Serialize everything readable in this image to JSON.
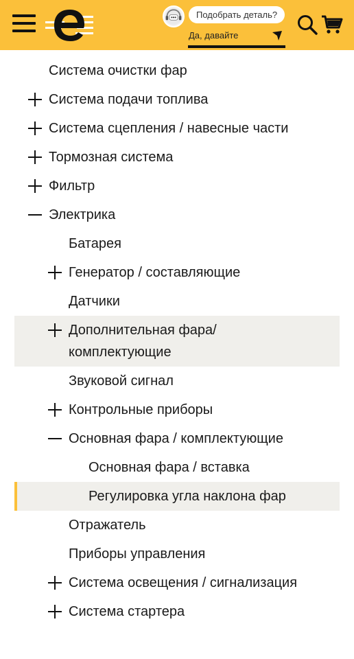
{
  "header": {
    "chat_bubble": "Подобрать деталь?",
    "reply_text": "Да, давайте",
    "brand_color": "#fbc03a"
  },
  "tree": [
    {
      "label": "Система очистки фар",
      "level": 0,
      "toggle": "none"
    },
    {
      "label": "Система подачи топлива",
      "level": 0,
      "toggle": "plus"
    },
    {
      "label": "Система сцепления / навесные части",
      "level": 0,
      "toggle": "plus"
    },
    {
      "label": "Тормозная система",
      "level": 0,
      "toggle": "plus"
    },
    {
      "label": "Фильтр",
      "level": 0,
      "toggle": "plus"
    },
    {
      "label": "Электрика",
      "level": 0,
      "toggle": "minus"
    },
    {
      "label": "Батарея",
      "level": 1,
      "toggle": "none"
    },
    {
      "label": "Генератор / составляющие",
      "level": 1,
      "toggle": "plus"
    },
    {
      "label": "Датчики",
      "level": 1,
      "toggle": "none"
    },
    {
      "label": "Дополнительная фара/ комплектующие",
      "level": 1,
      "toggle": "plus",
      "state": "hover"
    },
    {
      "label": "Звуковой сигнал",
      "level": 1,
      "toggle": "none"
    },
    {
      "label": "Контрольные приборы",
      "level": 1,
      "toggle": "plus"
    },
    {
      "label": "Основная фара / комплектующие",
      "level": 1,
      "toggle": "minus"
    },
    {
      "label": "Основная фара / вставка",
      "level": 2,
      "toggle": "none"
    },
    {
      "label": "Регулировка угла наклона фар",
      "level": 2,
      "toggle": "none",
      "state": "selected"
    },
    {
      "label": "Отражатель",
      "level": 1,
      "toggle": "none"
    },
    {
      "label": "Приборы управления",
      "level": 1,
      "toggle": "none"
    },
    {
      "label": "Система освещения / сигнализация",
      "level": 1,
      "toggle": "plus"
    },
    {
      "label": "Система стартера",
      "level": 1,
      "toggle": "plus"
    }
  ]
}
